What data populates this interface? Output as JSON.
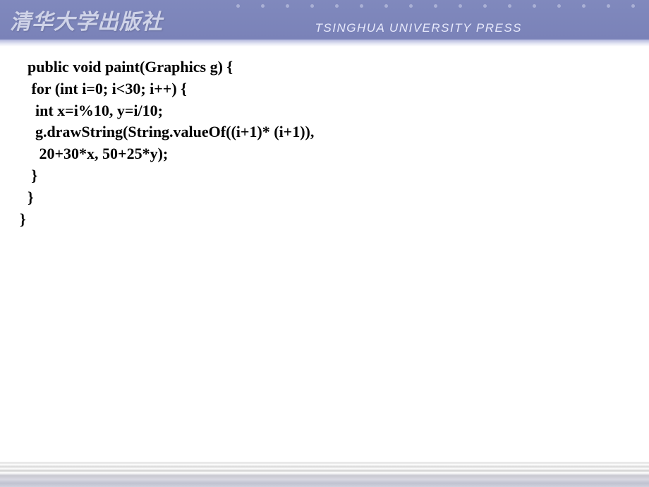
{
  "header": {
    "logo_cn": "清华大学出版社",
    "logo_en": "TSINGHUA UNIVERSITY PRESS"
  },
  "code": {
    "lines": [
      "  public void paint(Graphics g) {",
      "   for (int i=0; i<30; i++) {",
      "    int x=i%10, y=i/10;",
      "    g.drawString(String.valueOf((i+1)* (i+1)),",
      "     20+30*x, 50+25*y);",
      "   }",
      "  }",
      "}"
    ]
  }
}
